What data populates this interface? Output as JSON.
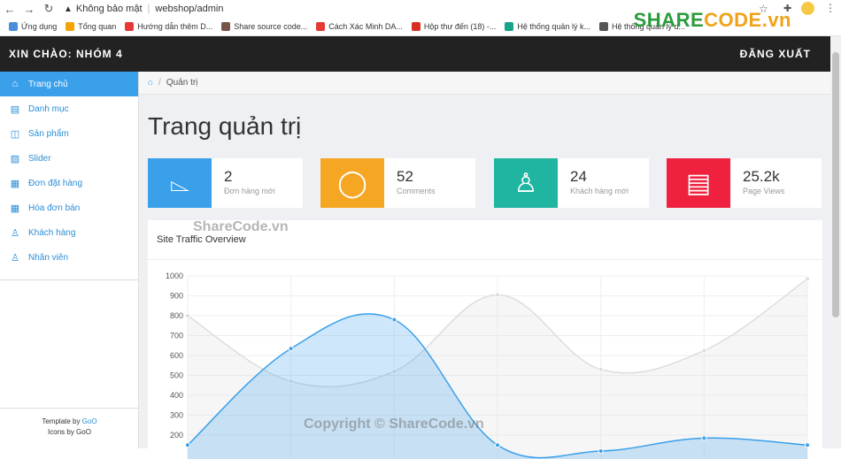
{
  "browser": {
    "security": "Không bảo mật",
    "url": "webshop/admin",
    "bookmarks": [
      "Ứng dụng",
      "Tổng quan",
      "Hướng dẫn thêm D...",
      "Share source code...",
      "Cách Xác Minh DA...",
      "Hộp thư đến (18) -...",
      "Hệ thống quản lý k...",
      "Hệ thống quản lý d..."
    ],
    "bookmark_colors": [
      "#4a90d9",
      "#f4a300",
      "#e53935",
      "#795548",
      "#e53935",
      "#d93025",
      "#17a589",
      "#555555"
    ]
  },
  "brand": {
    "part1": "SHARE",
    "part2": "CODE.vn"
  },
  "topbar": {
    "greeting": "XIN CHÀO: NHÓM 4",
    "logout": "ĐĂNG XUẤT"
  },
  "sidebar": {
    "items": [
      {
        "label": "Trang chủ",
        "icon": "home-icon"
      },
      {
        "label": "Danh mục",
        "icon": "list-icon"
      },
      {
        "label": "Sản phẩm",
        "icon": "bag-icon"
      },
      {
        "label": "Slider",
        "icon": "image-icon"
      },
      {
        "label": "Đơn đặt hàng",
        "icon": "table-icon"
      },
      {
        "label": "Hóa đơn bán",
        "icon": "table-icon"
      },
      {
        "label": "Khách hàng",
        "icon": "user-icon"
      },
      {
        "label": "Nhân viên",
        "icon": "user-icon"
      }
    ],
    "footer_line1": "Template by ",
    "footer_link1": "GoO",
    "footer_line2": "Icons by GoO"
  },
  "breadcrumb": {
    "current": "Quản trị"
  },
  "page": {
    "title": "Trang quản trị"
  },
  "stats": [
    {
      "value": "2",
      "label": "Đơn hàng mới",
      "color": "#3aa0ea",
      "icon": "shopping-bag-icon"
    },
    {
      "value": "52",
      "label": "Comments",
      "color": "#f5a623",
      "icon": "comment-icon"
    },
    {
      "value": "24",
      "label": "Khách hàng mới",
      "color": "#1fb5a0",
      "icon": "user-icon"
    },
    {
      "value": "25.2k",
      "label": "Page Views",
      "color": "#f0213e",
      "icon": "browser-window-icon"
    }
  ],
  "panel": {
    "title": "Site Traffic Overview"
  },
  "chart_data": {
    "type": "area",
    "ylim": [
      200,
      1000
    ],
    "yticks": [
      1000,
      900,
      800,
      700,
      600,
      500,
      400,
      300,
      200
    ],
    "series": [
      {
        "values": [
          800,
          470,
          520,
          905,
          530,
          625,
          985
        ],
        "color": "#dddddd"
      },
      {
        "values": [
          150,
          635,
          780,
          150,
          120,
          185,
          150
        ],
        "color": "#3aa0ea"
      }
    ]
  },
  "watermarks": {
    "center": "ShareCode.vn",
    "bottom": "Copyright © ShareCode.vn"
  }
}
